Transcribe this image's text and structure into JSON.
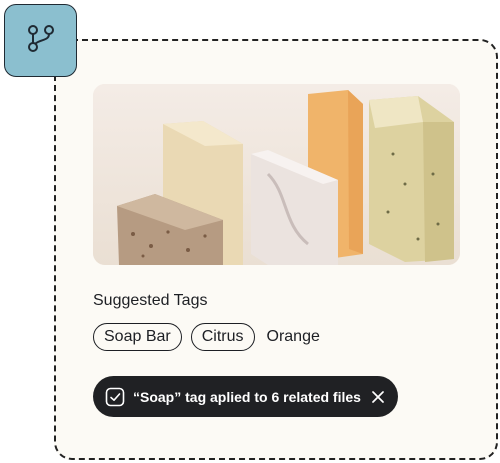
{
  "icons": {
    "badge": "git-branch-icon",
    "toast_check": "check-square-icon",
    "toast_close": "close-icon"
  },
  "colors": {
    "badge_bg": "#8bbfcf",
    "card_bg": "#fcfaf5",
    "toast_bg": "#202124"
  },
  "suggested_tags": {
    "title": "Suggested Tags",
    "chips": [
      "Soap Bar",
      "Citrus"
    ],
    "plain": "Orange"
  },
  "toast": {
    "message": "“Soap” tag aplied to 6 related files"
  }
}
